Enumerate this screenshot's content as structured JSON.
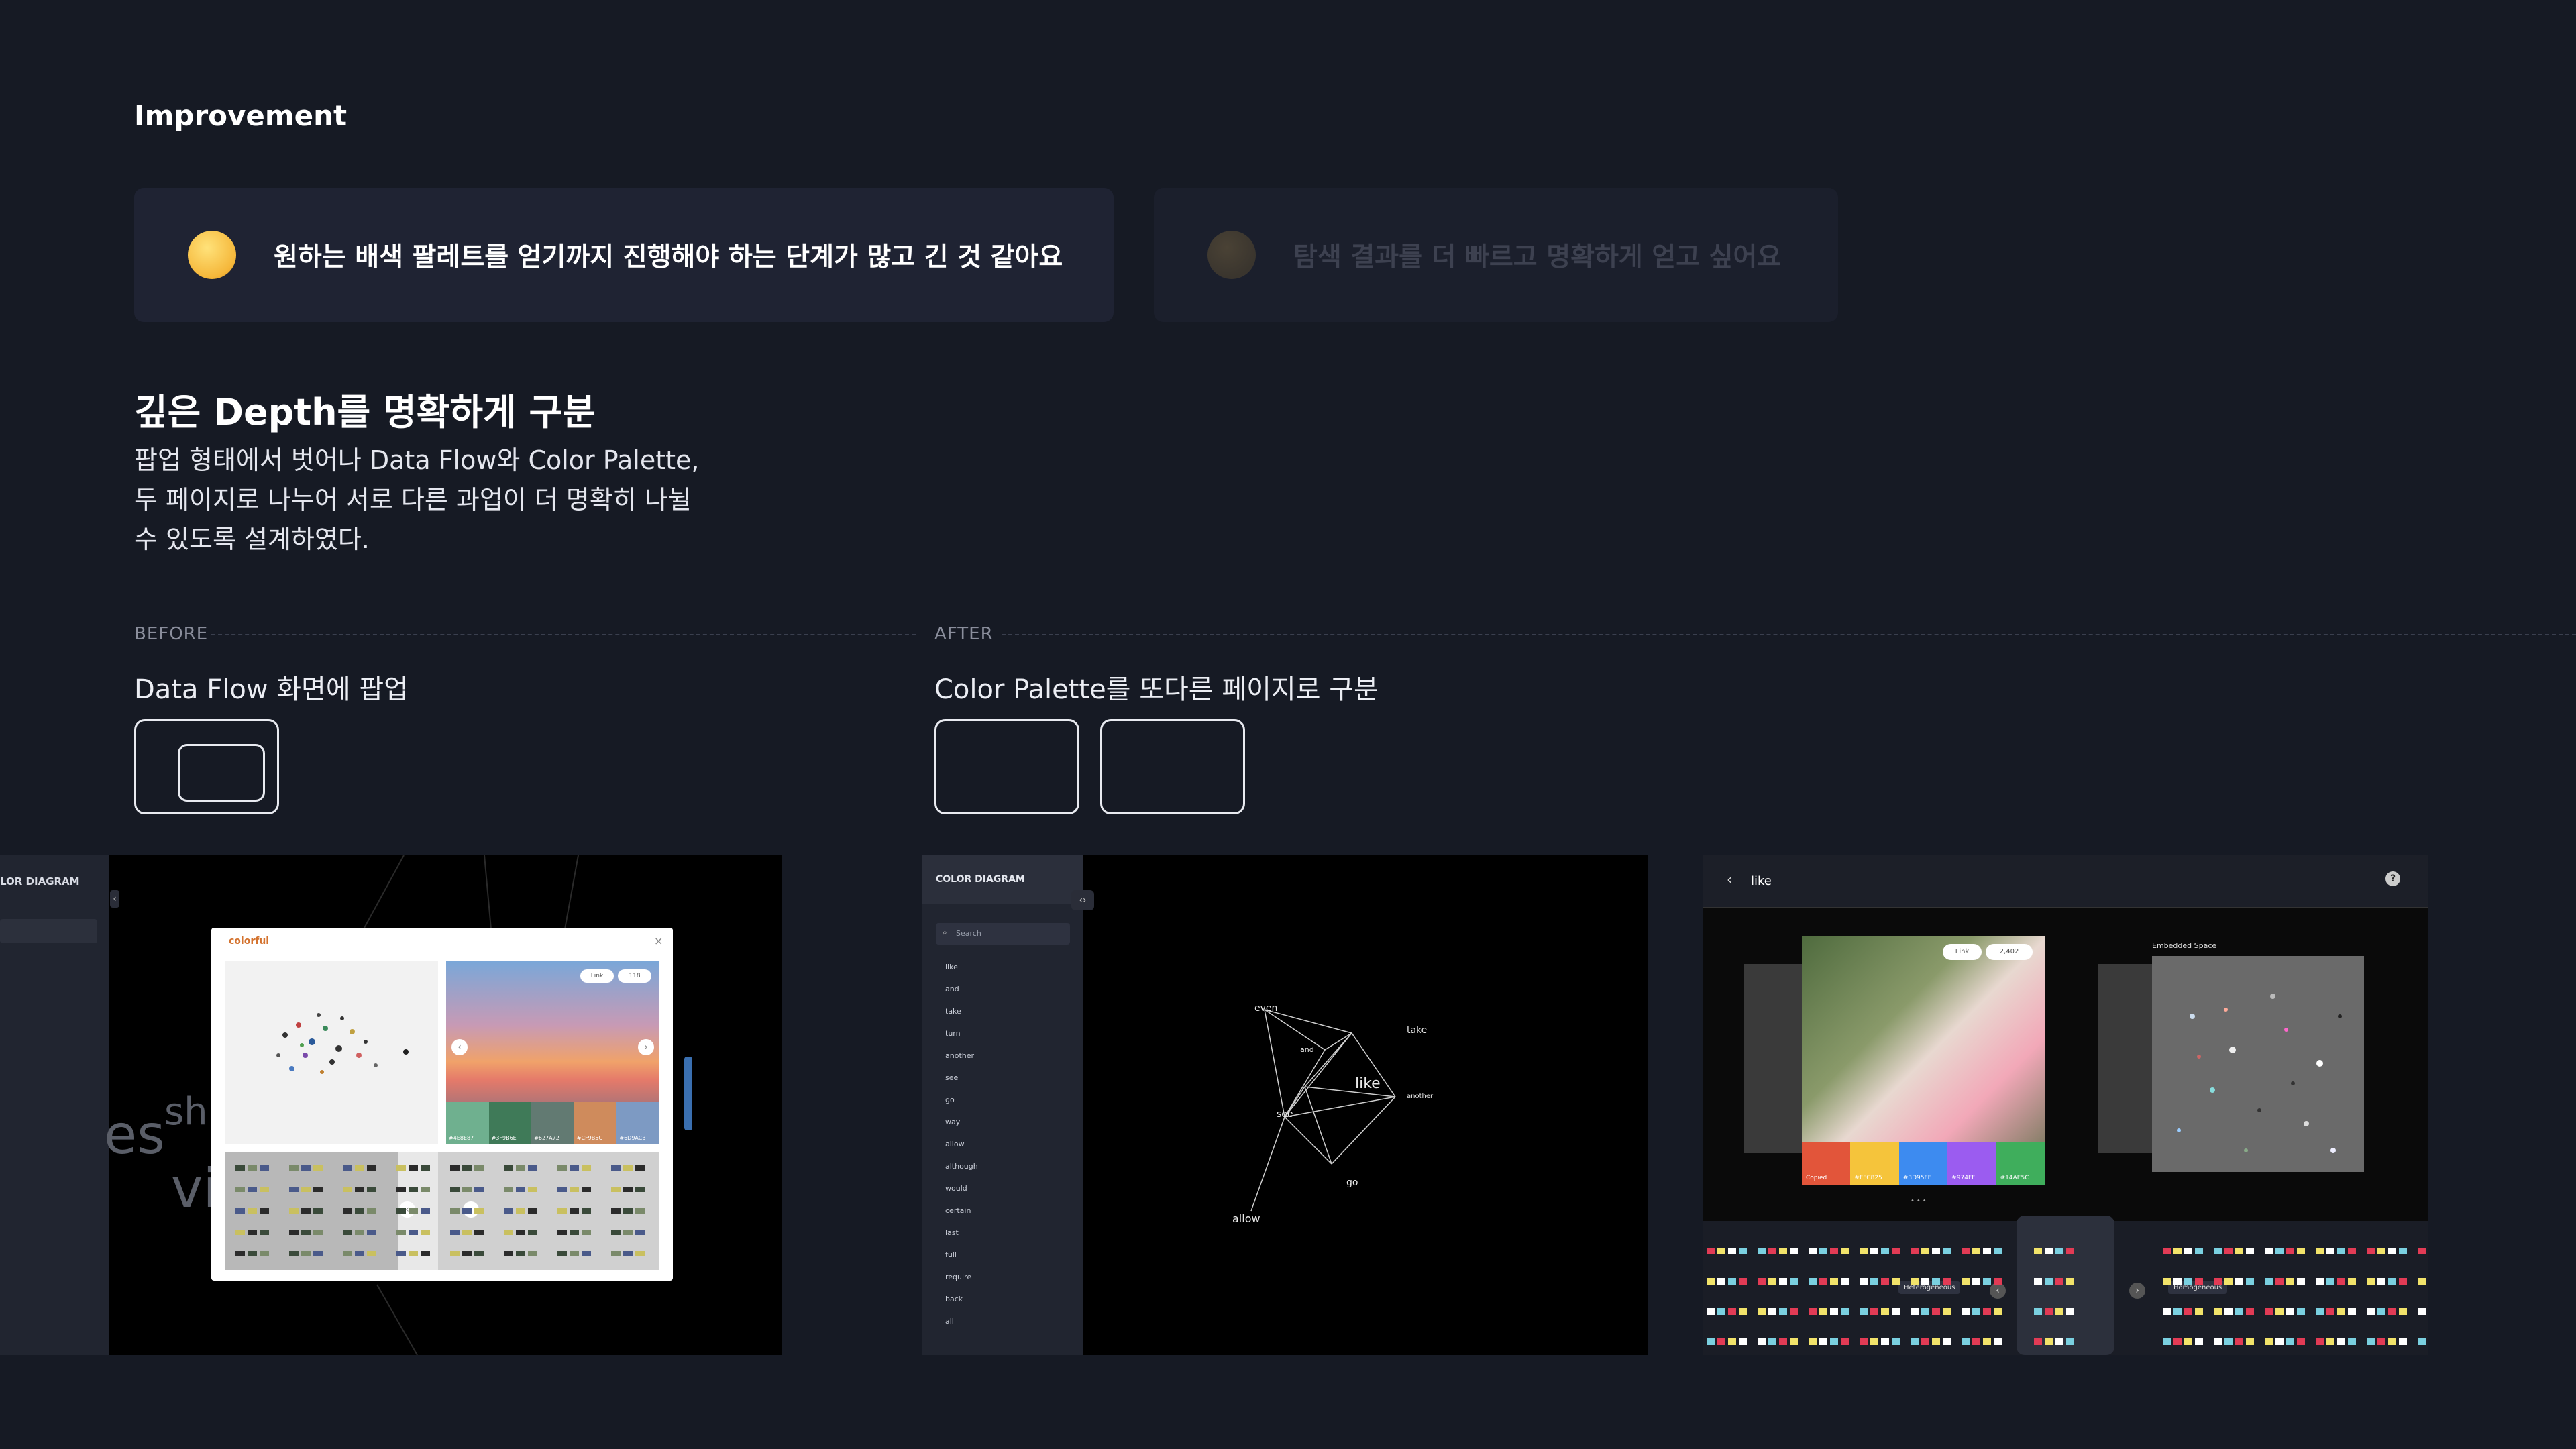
{
  "section_title": "Improvement",
  "cards": [
    {
      "emoji": "melting-face-emoji",
      "text": "원하는 배색 팔레트를 얻기까지 진행해야 하는 단계가 많고 긴 것 같아요"
    },
    {
      "emoji": "hushed-face-emoji",
      "text": "탐색 결과를 더 빠르고 명확하게 얻고 싶어요"
    }
  ],
  "heading": "깊은 Depth를 명확하게 구분",
  "description": [
    "팝업 형태에서 벗어나 Data Flow와 Color Palette,",
    "두 페이지로 나누어 서로 다른 과업이 더 명확히 나뉠",
    "수 있도록 설계하였다."
  ],
  "before": {
    "label": "BEFORE",
    "subtitle": "Data Flow 화면에 팝업"
  },
  "after": {
    "label": "AFTER",
    "subtitle": "Color Palette를 또다른 페이지로 구분"
  },
  "shot1": {
    "sidebar_title": "LOR DIAGRAM",
    "popup_title": "colorful",
    "link_label": "Link",
    "likes": "118",
    "swatch_codes": [
      "#4E8E87",
      "#3F9B6E",
      "#627A72",
      "#CF9B5C",
      "#6D9AC3"
    ],
    "bg_words": [
      "es",
      "sh",
      "vi"
    ]
  },
  "shot2": {
    "sidebar_title": "COLOR DIAGRAM",
    "search_placeholder": "Search",
    "items": [
      "like",
      "and",
      "take",
      "turn",
      "another",
      "see",
      "go",
      "way",
      "allow",
      "although",
      "would",
      "certain",
      "last",
      "full",
      "require",
      "back",
      "all"
    ],
    "graph_words": [
      "even",
      "take",
      "and",
      "like",
      "another",
      "see",
      "go",
      "allow"
    ]
  },
  "shot3": {
    "title": "like",
    "embedded_label": "Embedded Space",
    "link_label": "Link",
    "likes": "2,402",
    "swatches": [
      {
        "label": "Copied",
        "color": "#e2553a"
      },
      {
        "label": "#FFC825",
        "color": "#f5c43b"
      },
      {
        "label": "#3D95FF",
        "color": "#3d8bf0"
      },
      {
        "label": "#974FF",
        "color": "#9b5cf0"
      },
      {
        "label": "#14AE5C",
        "color": "#3fae5c"
      }
    ],
    "tag_left": "Heterogeneous",
    "tag_right": "Homogeneous"
  },
  "colors": {
    "background": "#161a24",
    "card": "#1f2333"
  }
}
